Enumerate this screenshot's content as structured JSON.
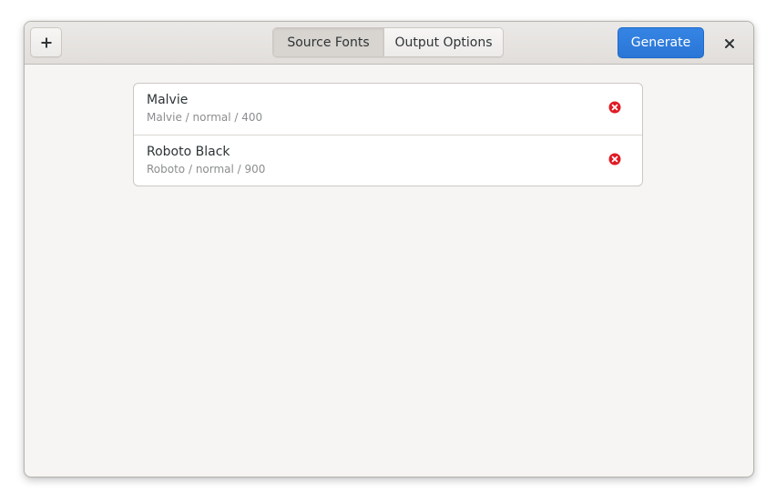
{
  "headerbar": {
    "add_icon": "plus-icon",
    "tabs": [
      {
        "label": "Source Fonts",
        "active": true
      },
      {
        "label": "Output Options",
        "active": false
      }
    ],
    "generate_label": "Generate",
    "close_icon": "close-icon"
  },
  "fonts": [
    {
      "name": "Malvie",
      "details": "Malvie / normal / 400",
      "remove_icon": "remove-circle-icon"
    },
    {
      "name": "Roboto Black",
      "details": "Roboto / normal / 900",
      "remove_icon": "remove-circle-icon"
    }
  ],
  "colors": {
    "accent": "#3584e4",
    "remove": "#e01b24"
  }
}
